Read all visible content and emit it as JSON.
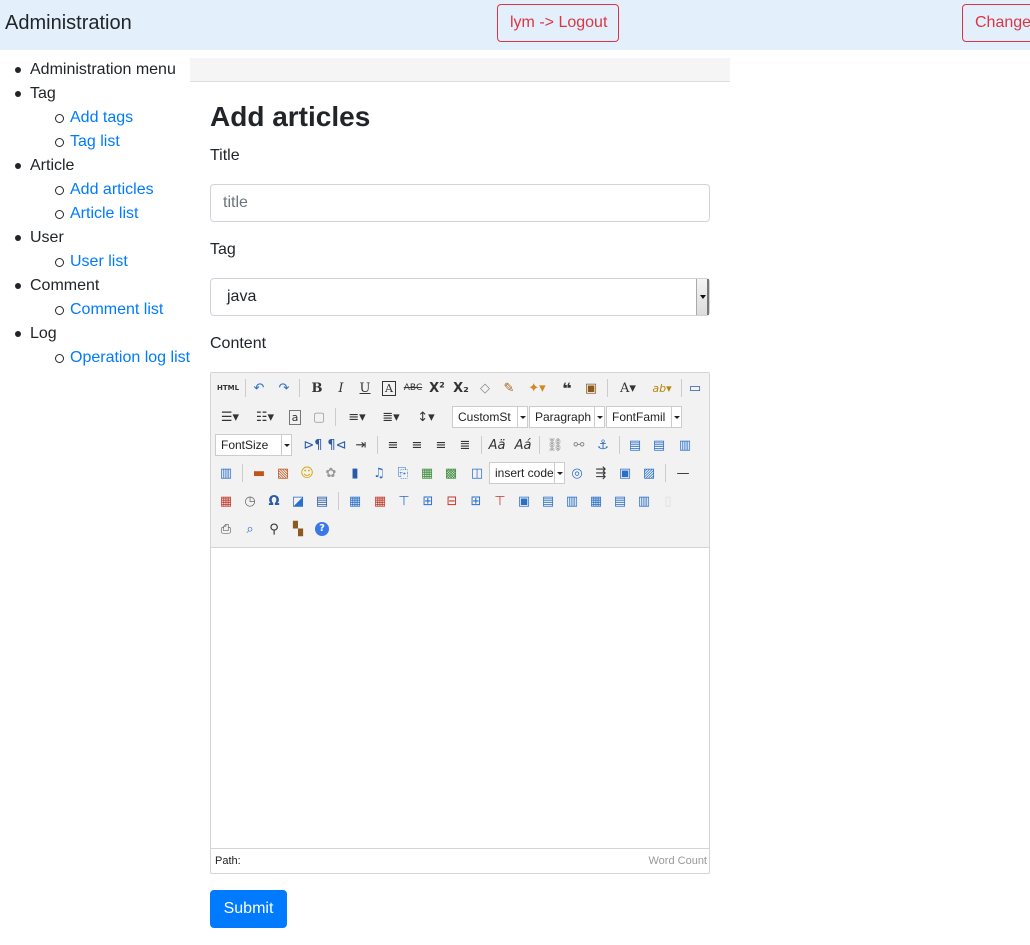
{
  "header": {
    "brand": "Administration",
    "logout_label": "lym -> Logout",
    "change_label": "Change"
  },
  "sidebar": {
    "groups": [
      {
        "label": "Administration menu",
        "items": []
      },
      {
        "label": "Tag",
        "items": [
          "Add tags",
          "Tag list"
        ]
      },
      {
        "label": "Article",
        "items": [
          "Add articles",
          "Article list"
        ]
      },
      {
        "label": "User",
        "items": [
          "User list"
        ]
      },
      {
        "label": "Comment",
        "items": [
          "Comment list"
        ]
      },
      {
        "label": "Log",
        "items": [
          "Operation log list"
        ]
      }
    ]
  },
  "form": {
    "page_title": "Add articles",
    "title_label": "Title",
    "title_placeholder": "title",
    "tag_label": "Tag",
    "tag_selected": "java",
    "content_label": "Content",
    "submit_label": "Submit"
  },
  "editor": {
    "combos": {
      "custom_style": "CustomSt",
      "paragraph": "Paragraph",
      "font_family": "FontFamil",
      "font_size": "FontSize",
      "insert_code": "insert code"
    },
    "path_label": "Path:",
    "word_count_label": "Word Count"
  }
}
